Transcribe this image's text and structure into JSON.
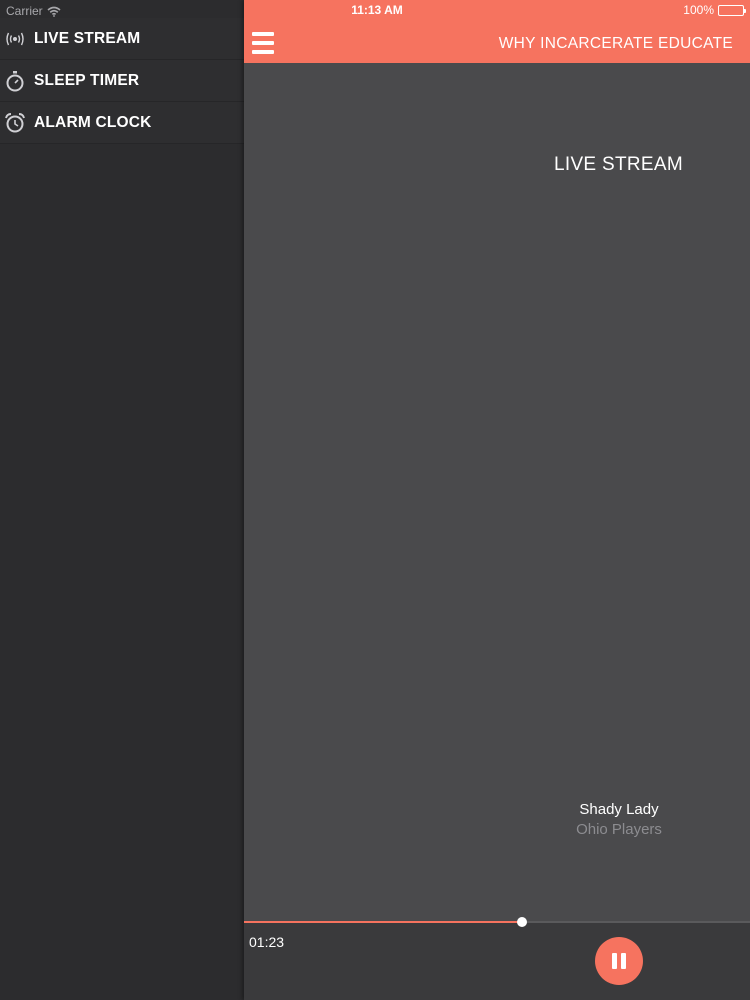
{
  "status_bar": {
    "carrier": "Carrier",
    "time": "11:13 AM",
    "battery": "100%"
  },
  "sidebar": {
    "items": [
      {
        "label": "LIVE STREAM",
        "icon": "broadcast-icon"
      },
      {
        "label": "SLEEP TIMER",
        "icon": "stopwatch-icon"
      },
      {
        "label": "ALARM CLOCK",
        "icon": "alarm-clock-icon"
      }
    ]
  },
  "header": {
    "title": "WHY INCARCERATE EDUCATE",
    "menu_icon": "hamburger-menu-icon"
  },
  "main": {
    "section_title": "LIVE STREAM"
  },
  "now_playing": {
    "title": "Shady Lady",
    "artist": "Ohio Players"
  },
  "player": {
    "elapsed": "01:23",
    "progress": 0.55,
    "state_icon": "pause-icon"
  },
  "colors": {
    "accent": "#f6735f",
    "sidebar_bg": "#2c2c2e",
    "main_bg": "#4a4a4c",
    "player_bg": "#3a3a3c",
    "muted_text": "#8c8c90"
  }
}
